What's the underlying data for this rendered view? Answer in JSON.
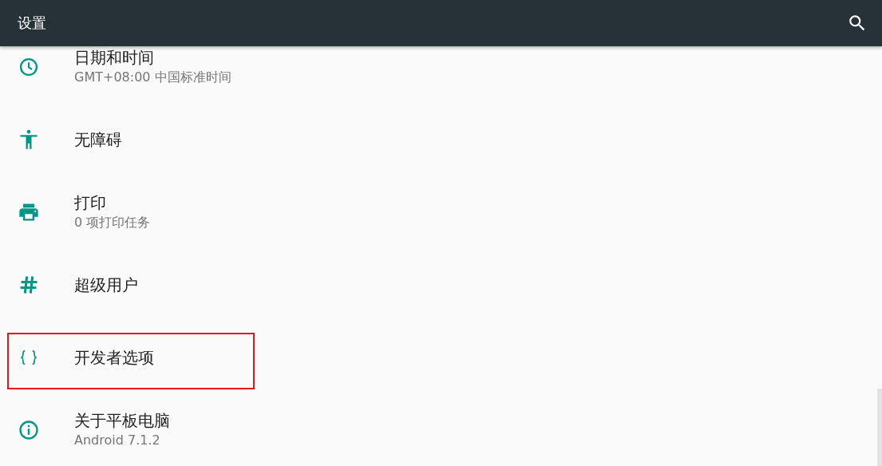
{
  "app_bar": {
    "title": "设置"
  },
  "items": [
    {
      "title": "日期和时间",
      "subtitle": "GMT+08:00 中国标准时间",
      "highlighted": false
    },
    {
      "title": "无障碍",
      "highlighted": false
    },
    {
      "title": "打印",
      "subtitle": "0 项打印任务",
      "highlighted": false
    },
    {
      "title": "超级用户",
      "highlighted": false
    },
    {
      "title": "开发者选项",
      "highlighted": true
    },
    {
      "title": "关于平板电脑",
      "subtitle": "Android 7.1.2",
      "highlighted": false
    }
  ]
}
